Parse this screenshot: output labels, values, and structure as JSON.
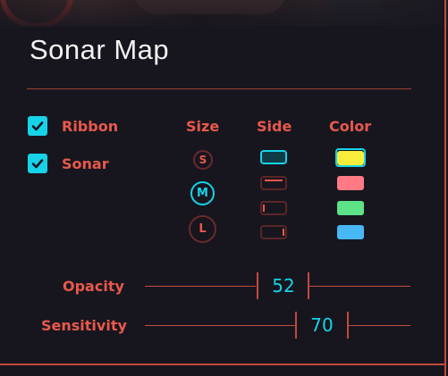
{
  "panel": {
    "title": "Sonar Map"
  },
  "toggles": [
    {
      "label": "Ribbon",
      "checked": true
    },
    {
      "label": "Sonar",
      "checked": true
    }
  ],
  "columns": {
    "size": "Size",
    "side": "Side",
    "color": "Color"
  },
  "size_options": [
    {
      "label": "S",
      "selected": false
    },
    {
      "label": "M",
      "selected": true
    },
    {
      "label": "L",
      "selected": false
    }
  ],
  "side_options": [
    {
      "name": "all",
      "selected": true
    },
    {
      "name": "top",
      "selected": false
    },
    {
      "name": "left",
      "selected": false
    },
    {
      "name": "right",
      "selected": false
    }
  ],
  "color_options": [
    {
      "hex": "#f7ee3c",
      "selected": true
    },
    {
      "hex": "#ff7a85",
      "selected": false
    },
    {
      "hex": "#5de287",
      "selected": false
    },
    {
      "hex": "#48b8f5",
      "selected": false
    }
  ],
  "sliders": {
    "opacity": {
      "label": "Opacity",
      "value": "52"
    },
    "sensitivity": {
      "label": "Sensitivity",
      "value": "70"
    }
  },
  "colors": {
    "accent": "#e8594b",
    "highlight": "#17d3e8",
    "background": "#17161f"
  }
}
